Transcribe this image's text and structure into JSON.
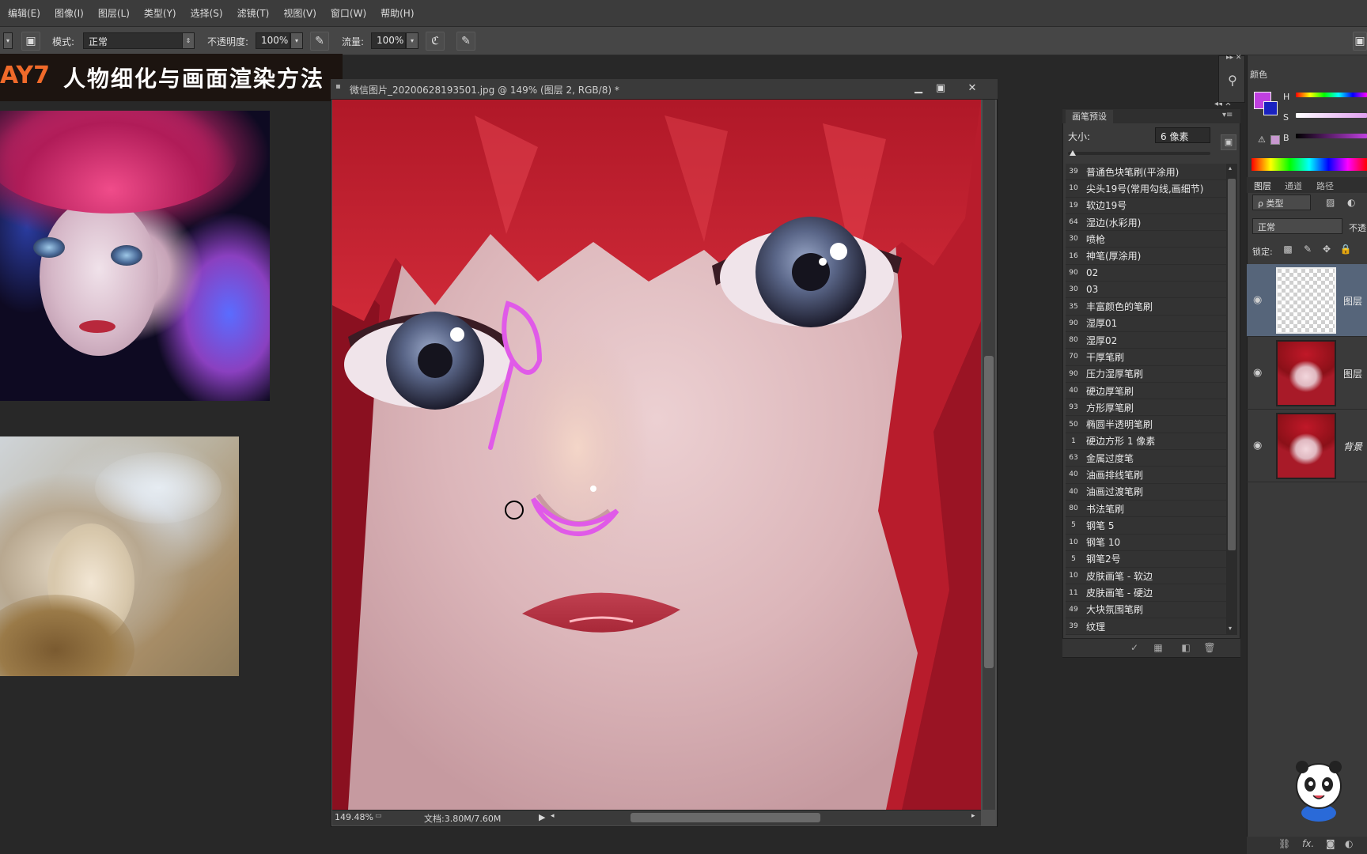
{
  "menubar": {
    "items": [
      "编辑(E)",
      "图像(I)",
      "图层(L)",
      "类型(Y)",
      "选择(S)",
      "滤镜(T)",
      "视图(V)",
      "窗口(W)",
      "帮助(H)"
    ]
  },
  "options": {
    "mode_label": "模式:",
    "mode_value": "正常",
    "opacity_label": "不透明度:",
    "opacity_value": "100%",
    "flow_label": "流量:",
    "flow_value": "100%"
  },
  "banner": {
    "day": "AY7",
    "title": "人物细化与画面渲染方法"
  },
  "document": {
    "title": "微信图片_20200628193501.jpg @ 149% (图层 2, RGB/8) *",
    "zoom": "149.48%",
    "doc_size": "文档:3.80M/7.60M"
  },
  "brush_panel": {
    "tab": "画笔预设",
    "size_label": "大小:",
    "size_value": "6 像素",
    "presets": [
      {
        "size": "39",
        "name": "普通色块笔刷(平涂用)"
      },
      {
        "size": "10",
        "name": "尖头19号(常用勾线,画细节)"
      },
      {
        "size": "19",
        "name": "软边19号"
      },
      {
        "size": "64",
        "name": "湿边(水彩用)"
      },
      {
        "size": "30",
        "name": "喷枪"
      },
      {
        "size": "16",
        "name": "神笔(厚涂用)"
      },
      {
        "size": "90",
        "name": "02"
      },
      {
        "size": "30",
        "name": "03"
      },
      {
        "size": "35",
        "name": "丰富颜色的笔刷"
      },
      {
        "size": "90",
        "name": "湿厚01"
      },
      {
        "size": "80",
        "name": "湿厚02"
      },
      {
        "size": "70",
        "name": "干厚笔刷"
      },
      {
        "size": "90",
        "name": "压力湿厚笔刷"
      },
      {
        "size": "40",
        "name": "硬边厚笔刷"
      },
      {
        "size": "93",
        "name": "方形厚笔刷"
      },
      {
        "size": "50",
        "name": "椭圆半透明笔刷"
      },
      {
        "size": "1",
        "name": "硬边方形 1 像素"
      },
      {
        "size": "63",
        "name": "金属过度笔"
      },
      {
        "size": "40",
        "name": "油画排线笔刷"
      },
      {
        "size": "40",
        "name": "油画过渡笔刷"
      },
      {
        "size": "80",
        "name": "书法笔刷"
      },
      {
        "size": "5",
        "name": "钢笔 5"
      },
      {
        "size": "10",
        "name": "钢笔 10"
      },
      {
        "size": "5",
        "name": "钢笔2号"
      },
      {
        "size": "10",
        "name": "皮肤画笔 - 软边"
      },
      {
        "size": "11",
        "name": "皮肤画笔 - 硬边"
      },
      {
        "size": "49",
        "name": "大块氛围笔刷"
      },
      {
        "size": "39",
        "name": "纹理"
      }
    ]
  },
  "color_panel": {
    "tab": "颜色",
    "h_label": "H",
    "s_label": "S",
    "b_label": "B",
    "foreground": "#c040e0",
    "background": "#1a22c0"
  },
  "layers_panel": {
    "tabs": [
      "图层",
      "通道",
      "路径"
    ],
    "kind_filter": "ρ 类型",
    "blend_mode": "正常",
    "opacity_label": "不透",
    "lock_label": "锁定:",
    "layers": [
      {
        "name": "图层",
        "selected": true,
        "thumb": "transparent"
      },
      {
        "name": "图层",
        "selected": false,
        "thumb": "art"
      },
      {
        "name": "背景",
        "selected": false,
        "thumb": "art"
      }
    ]
  }
}
